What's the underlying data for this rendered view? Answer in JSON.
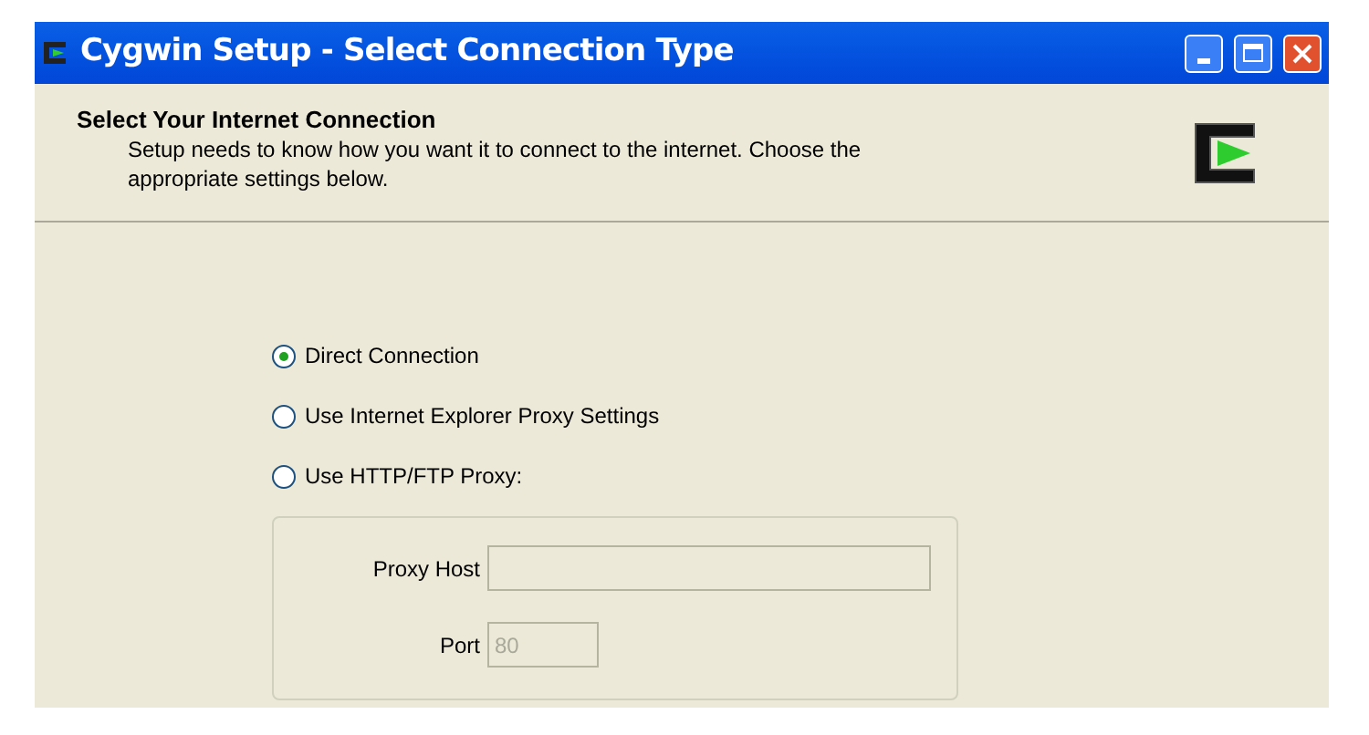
{
  "window": {
    "title": "Cygwin Setup - Select Connection Type"
  },
  "header": {
    "title": "Select Your Internet Connection",
    "description": "Setup needs to know how you want it to connect to the internet.  Choose the appropriate settings below."
  },
  "options": [
    {
      "label": "Direct Connection",
      "selected": true
    },
    {
      "label": "Use Internet Explorer Proxy Settings",
      "selected": false
    },
    {
      "label": "Use HTTP/FTP Proxy:",
      "selected": false
    }
  ],
  "proxy": {
    "fields": [
      {
        "label": "Proxy Host",
        "disabled": true
      },
      {
        "label": "Port",
        "value": "80",
        "disabled": true
      }
    ]
  }
}
